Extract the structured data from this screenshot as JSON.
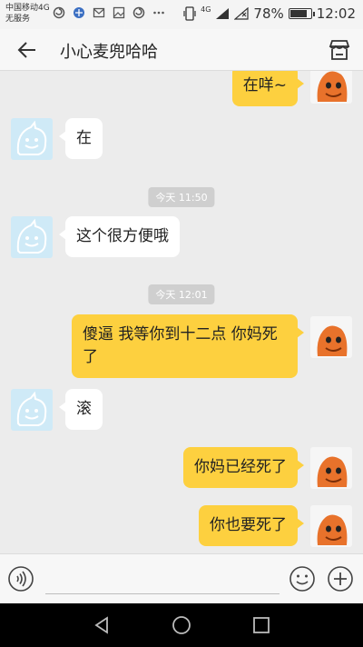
{
  "status_bar": {
    "carrier": "中国移动4G",
    "service": "无服务",
    "network": "4G",
    "battery": "78%",
    "battery_level": 0.78,
    "time": "12:02"
  },
  "header": {
    "title": "小心麦兜哈哈"
  },
  "messages": [
    {
      "side": "right",
      "text": "在咩~"
    },
    {
      "side": "left",
      "text": "在"
    },
    {
      "type": "time",
      "text": "今天 11:50"
    },
    {
      "side": "left",
      "text": "这个很方便哦"
    },
    {
      "type": "time",
      "text": "今天 12:01"
    },
    {
      "side": "right",
      "text": "傻逼 我等你到十二点 你妈死",
      "text2": "了"
    },
    {
      "side": "left",
      "text": "滚"
    },
    {
      "side": "right",
      "text": "你妈已经死了"
    },
    {
      "side": "right",
      "text": "你也要死了"
    }
  ],
  "input": {
    "value": ""
  },
  "icons": {
    "back": "back-arrow-icon",
    "shop": "shop-icon",
    "voice": "voice-icon",
    "emoji": "emoji-icon",
    "plus": "plus-icon",
    "nav_back": "triangle-back-icon",
    "nav_home": "circle-home-icon",
    "nav_recent": "square-recent-icon"
  },
  "colors": {
    "bubble_self": "#fdd03f",
    "bubble_other": "#ffffff",
    "chat_bg": "#ececec"
  }
}
